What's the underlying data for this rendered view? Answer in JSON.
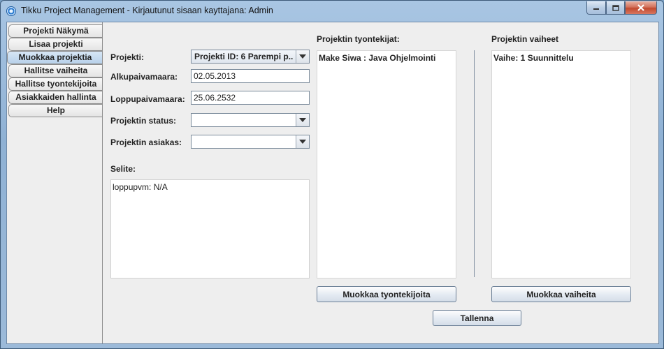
{
  "window": {
    "title": "Tikku Project Management - Kirjautunut sisaan kayttajana: Admin"
  },
  "tabs": [
    {
      "label": "Projekti Näkymä"
    },
    {
      "label": "Lisaa projekti"
    },
    {
      "label": "Muokkaa projektia"
    },
    {
      "label": "Hallitse vaiheita"
    },
    {
      "label": "Hallitse tyontekijoita"
    },
    {
      "label": "Asiakkaiden hallinta"
    },
    {
      "label": "Help"
    }
  ],
  "active_tab": "Muokkaa projektia",
  "form": {
    "projekti_label": "Projekti:",
    "projekti_value": "Projekti ID: 6 Parempi p...",
    "alku_label": "Alkupaivamaara:",
    "alku_value": "02.05.2013",
    "loppu_label": "Loppupaivamaara:",
    "loppu_value": "25.06.2532",
    "status_label": "Projektin status:",
    "status_value": "",
    "asiakas_label": "Projektin asiakas:",
    "asiakas_value": "",
    "selite_label": "Selite:",
    "selite_value": "loppupvm: N/A"
  },
  "employees": {
    "heading": "Projektin tyontekijat:",
    "items": [
      "Make Siwa : Java Ohjelmointi"
    ],
    "button": "Muokkaa tyontekijoita"
  },
  "phases": {
    "heading": "Projektin vaiheet",
    "items": [
      "Vaihe: 1 Suunnittelu"
    ],
    "button": "Muokkaa vaiheita"
  },
  "save_button": "Tallenna",
  "colors": {
    "active_tab": "#b8d1ea",
    "panel_bg": "#eeeeee",
    "close_button": "#c2492f"
  }
}
